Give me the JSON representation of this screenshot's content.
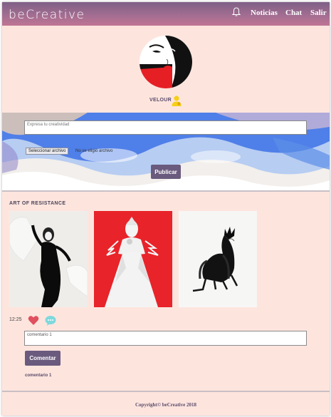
{
  "navbar": {
    "brand": "beCreative",
    "links": {
      "news": "Noticias",
      "chat": "Chat",
      "logout": "Salir"
    },
    "bell_icon": "bell-icon"
  },
  "profile": {
    "username": "VELOUR",
    "user_icon": "user-icon"
  },
  "post_form": {
    "placeholder": "Expresa tu creatividad",
    "file_button": "Seleccionar archivo",
    "file_status": "No se eligió archivo",
    "publish_label": "Publicar"
  },
  "album": {
    "title": "ART OF RESISTANCE",
    "time": "12:25",
    "like_icon": "heart-icon",
    "comment_icon": "comment-bubble-icon",
    "comment_input_value": "comentario 1",
    "comment_button": "Comentar",
    "comments": [
      "comentario 1"
    ]
  },
  "footer": {
    "text": "Copyright© beCreative 2018"
  },
  "colors": {
    "page_bg": "#fde5de",
    "nav_start": "#7e5f86",
    "nav_end": "#c07594",
    "button": "#6a5a7d",
    "heart": "#e0505f",
    "bubble": "#7fd8dc"
  }
}
